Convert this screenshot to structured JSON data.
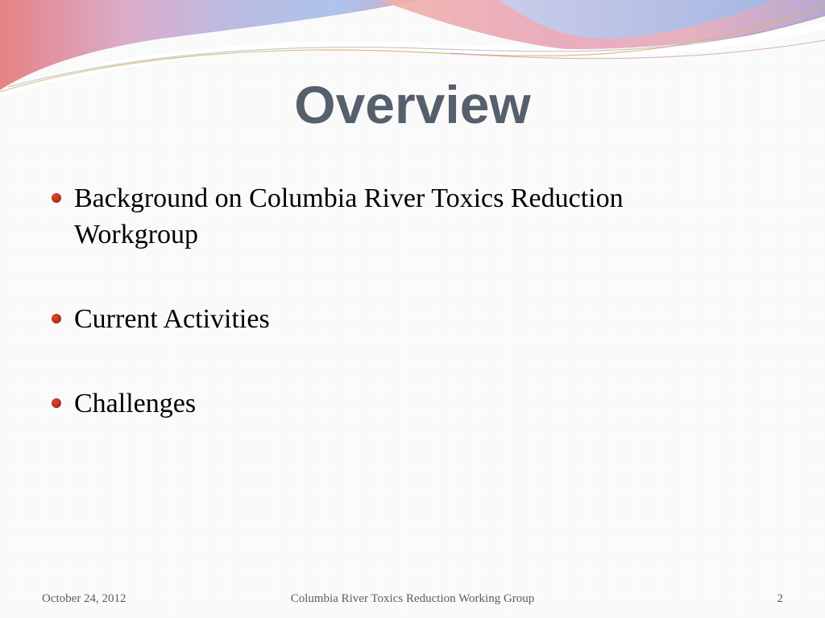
{
  "slide": {
    "title": "Overview",
    "bullets": [
      "Background on Columbia River Toxics Reduction Workgroup",
      "Current Activities",
      "Challenges"
    ],
    "footer": {
      "date": "October 24, 2012",
      "center": "Columbia River Toxics Reduction Working Group",
      "page_number": "2"
    }
  },
  "colors": {
    "title": "#56606c",
    "bullet": "#c0301e",
    "footer": "#56606c",
    "wave_pink": "#e2a7bb",
    "wave_blue": "#a9c1ea",
    "wave_coral": "#e57b7e"
  }
}
